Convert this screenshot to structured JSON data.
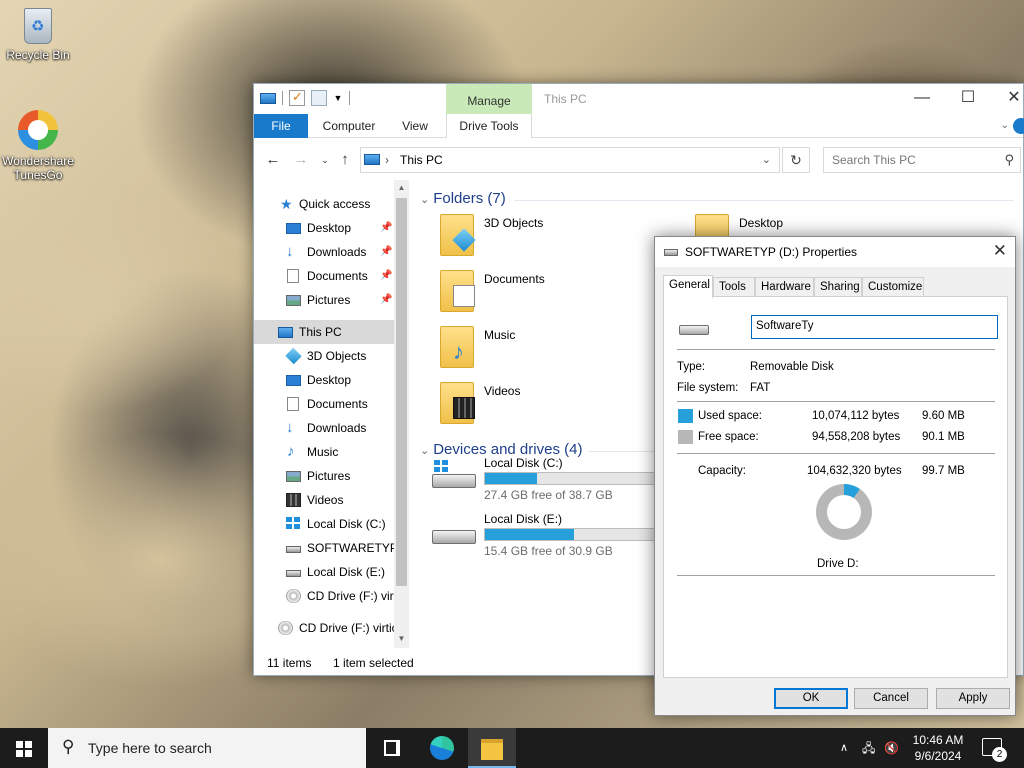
{
  "desktop": {
    "icons": [
      {
        "label": "Recycle Bin"
      },
      {
        "label": "Wondershare\nTunesGo"
      }
    ]
  },
  "explorer": {
    "title": "This PC",
    "manage_tab": "Manage",
    "ribbon_tabs": [
      "File",
      "Computer",
      "View",
      "Drive Tools"
    ],
    "address_path": "This PC",
    "search_placeholder": "Search This PC",
    "nav": {
      "quick_access": "Quick access",
      "items": [
        {
          "label": "Desktop",
          "icon": "desktop-icon"
        },
        {
          "label": "Downloads",
          "icon": "downloads-icon"
        },
        {
          "label": "Documents",
          "icon": "documents-icon"
        },
        {
          "label": "Pictures",
          "icon": "pictures-icon"
        },
        {
          "label": "This PC",
          "icon": "this-pc-icon"
        },
        {
          "label": "3D Objects",
          "icon": "3d-objects-icon"
        },
        {
          "label": "Desktop",
          "icon": "desktop-icon"
        },
        {
          "label": "Documents",
          "icon": "documents-icon"
        },
        {
          "label": "Downloads",
          "icon": "downloads-icon"
        },
        {
          "label": "Music",
          "icon": "music-icon"
        },
        {
          "label": "Pictures",
          "icon": "pictures-icon"
        },
        {
          "label": "Videos",
          "icon": "videos-icon"
        },
        {
          "label": "Local Disk (C:)",
          "icon": "windows-drive-icon"
        },
        {
          "label": "SOFTWARETYP (",
          "icon": "removable-drive-icon"
        },
        {
          "label": "Local Disk (E:)",
          "icon": "drive-icon"
        },
        {
          "label": "CD Drive (F:) virt",
          "icon": "cd-drive-icon"
        },
        {
          "label": "CD Drive (F:) virtic",
          "icon": "cd-drive-icon"
        }
      ]
    },
    "folders_header": "Folders (7)",
    "folders": [
      {
        "name": "3D Objects",
        "icon": "3d-objects-icon"
      },
      {
        "name": "Desktop",
        "icon": "desktop-icon"
      },
      {
        "name": "Documents",
        "icon": "documents-icon"
      },
      {
        "name": "Music",
        "icon": "music-icon"
      },
      {
        "name": "Videos",
        "icon": "videos-icon"
      }
    ],
    "drives_header": "Devices and drives (4)",
    "drives": [
      {
        "name": "Local Disk (C:)",
        "free": "27.4 GB free of 38.7 GB",
        "used_fraction": 0.29
      },
      {
        "name": "Local Disk (E:)",
        "free": "15.4 GB free of 30.9 GB",
        "used_fraction": 0.5
      }
    ],
    "status": {
      "items": "11 items",
      "selected": "1 item selected"
    }
  },
  "dialog": {
    "title": "SOFTWARETYP (D:) Properties",
    "tabs": [
      "General",
      "Tools",
      "Hardware",
      "Sharing",
      "Customize"
    ],
    "name_value": "SoftwareTy",
    "type_label": "Type:",
    "type_value": "Removable Disk",
    "fs_label": "File system:",
    "fs_value": "FAT",
    "used_label": "Used space:",
    "used_bytes": "10,074,112 bytes",
    "used_size": "9.60 MB",
    "free_label": "Free space:",
    "free_bytes": "94,558,208 bytes",
    "free_size": "90.1 MB",
    "capacity_label": "Capacity:",
    "capacity_bytes": "104,632,320 bytes",
    "capacity_size": "99.7 MB",
    "drive_label": "Drive D:",
    "used_fraction": 0.096,
    "colors": {
      "used": "#26a0da",
      "free": "#b7b7b7"
    },
    "buttons": {
      "ok": "OK",
      "cancel": "Cancel",
      "apply": "Apply"
    }
  },
  "taskbar": {
    "search_text": "Type here to search",
    "time": "10:46 AM",
    "date": "9/6/2024",
    "notification_count": "2"
  }
}
